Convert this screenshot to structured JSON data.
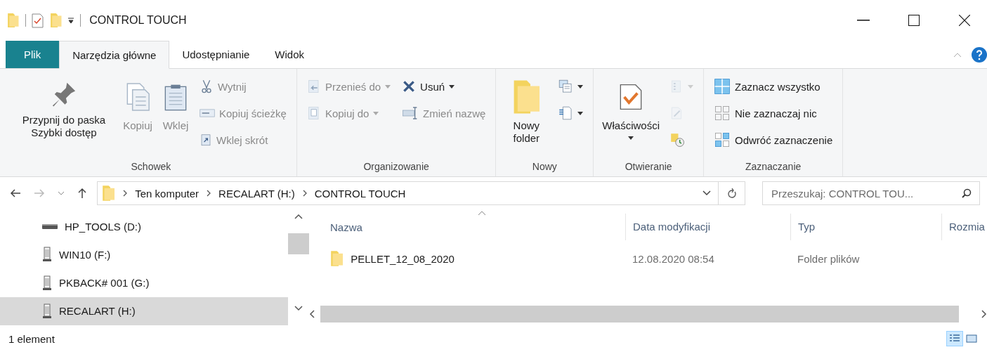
{
  "window": {
    "title": "CONTROL TOUCH"
  },
  "ribbon_tabs": [
    {
      "label": "Plik",
      "kind": "file",
      "selected": false
    },
    {
      "label": "Narzędzia główne",
      "kind": "tab",
      "selected": true
    },
    {
      "label": "Udostępnianie",
      "kind": "tab",
      "selected": false
    },
    {
      "label": "Widok",
      "kind": "tab",
      "selected": false
    }
  ],
  "ribbon_groups": [
    {
      "label": "Schowek",
      "columns": [
        [
          {
            "label": "Przypnij do paska Szybki dostęp",
            "kind": "large",
            "disabled": false
          }
        ],
        [
          {
            "label": "Kopiuj",
            "kind": "large",
            "disabled": true
          }
        ],
        [
          {
            "label": "Wklej",
            "kind": "large",
            "disabled": true
          }
        ],
        [
          {
            "label": "Wytnij",
            "kind": "small",
            "disabled": true
          },
          {
            "label": "Kopiuj ścieżkę",
            "kind": "small",
            "disabled": true
          },
          {
            "label": "Wklej skrót",
            "kind": "small",
            "disabled": true
          }
        ]
      ]
    },
    {
      "label": "Organizowanie",
      "columns": [
        [
          {
            "label": "Przenieś do",
            "kind": "small",
            "disabled": true,
            "dropdown": true
          },
          {
            "label": "Kopiuj do",
            "kind": "small",
            "disabled": true,
            "dropdown": true
          }
        ],
        [
          {
            "label": "Usuń",
            "kind": "small",
            "disabled": false,
            "dropdown": true
          },
          {
            "label": "Zmień nazwę",
            "kind": "small",
            "disabled": true
          }
        ]
      ]
    },
    {
      "label": "Nowy",
      "columns": [
        [
          {
            "label": "Nowy folder",
            "kind": "large",
            "disabled": false
          }
        ],
        [
          {
            "kind": "icon",
            "disabled": false,
            "dropdown": true
          },
          {
            "kind": "icon",
            "disabled": false,
            "dropdown": true
          }
        ]
      ]
    },
    {
      "label": "Otwieranie",
      "columns": [
        [
          {
            "label": "Właściwości",
            "kind": "large",
            "disabled": false,
            "dropdown": true
          }
        ],
        [
          {
            "kind": "icon",
            "disabled": true,
            "dropdown": true
          },
          {
            "kind": "icon",
            "disabled": true
          },
          {
            "kind": "icon",
            "disabled": false
          }
        ]
      ]
    },
    {
      "label": "Zaznaczanie",
      "columns": [
        [
          {
            "label": "Zaznacz wszystko",
            "kind": "small",
            "disabled": false
          },
          {
            "label": "Nie zaznaczaj nic",
            "kind": "small",
            "disabled": false
          },
          {
            "label": "Odwróć zaznaczenie",
            "kind": "small",
            "disabled": false
          }
        ]
      ]
    }
  ],
  "address": {
    "segments": [
      "Ten komputer",
      "RECALART (H:)",
      "CONTROL TOUCH"
    ]
  },
  "search": {
    "placeholder": "Przeszukaj: CONTROL TOU..."
  },
  "nav_pane": {
    "items": [
      {
        "label": "HP_TOOLS (D:)",
        "kind": "drive",
        "selected": false
      },
      {
        "label": "WIN10 (F:)",
        "kind": "usb",
        "selected": false
      },
      {
        "label": "PKBACK# 001 (G:)",
        "kind": "usb",
        "selected": false
      },
      {
        "label": "RECALART (H:)",
        "kind": "usb",
        "selected": true
      }
    ]
  },
  "file_list": {
    "columns": [
      "Nazwa",
      "Data modyfikacji",
      "Typ",
      "Rozmia"
    ],
    "rows": [
      {
        "cells": [
          "PELLET_12_08_2020",
          "12.08.2020 08:54",
          "Folder plików"
        ]
      }
    ]
  },
  "status_bar": {
    "text": "1 element",
    "view_buttons": [
      {
        "kind": "details",
        "selected": true
      },
      {
        "kind": "large_icons",
        "selected": false
      }
    ]
  }
}
